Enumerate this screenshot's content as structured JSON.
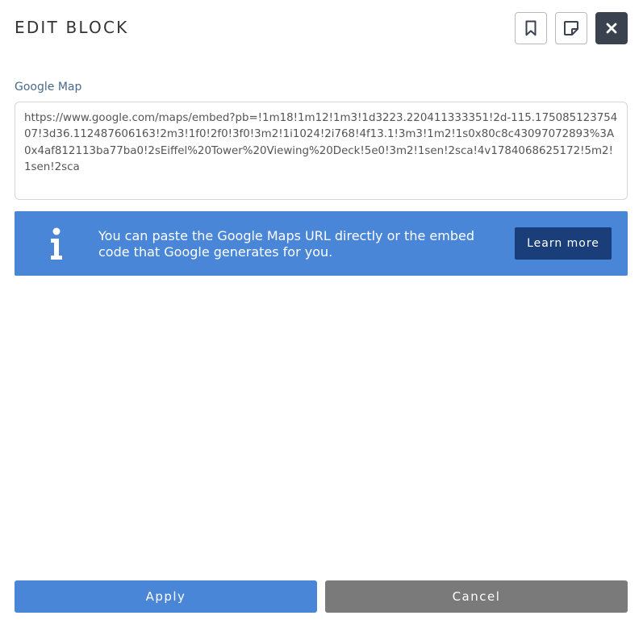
{
  "header": {
    "title": "EDIT BLOCK",
    "buttons": [
      {
        "icon": "bookmark-icon"
      },
      {
        "icon": "note-icon"
      },
      {
        "icon": "close-icon"
      }
    ]
  },
  "field": {
    "label": "Google Map",
    "value": "https://www.google.com/maps/embed?pb=!1m18!1m12!1m3!1d3223.220411333351!2d-115.17508512375407!3d36.112487606163!2m3!1f0!2f0!3f0!3m2!1i1024!2i768!4f13.1!3m3!1m2!1s0x80c8c43097072893%3A0x4af812113ba77ba0!2sEiffel%20Tower%20Viewing%20Deck!5e0!3m2!1sen!2sca!4v1784068625172!5m2!1sen!2sca"
  },
  "info": {
    "icon": "info-icon",
    "text": "You can paste the Google Maps URL directly or the embed code that Google generates for you.",
    "learn_more": "Learn more"
  },
  "footer": {
    "apply": "Apply",
    "cancel": "Cancel"
  },
  "colors": {
    "primary": "#4a86d8",
    "primary_dark": "#1a3e7a",
    "close_bg": "#39424e",
    "cancel_bg": "#7a7a7a",
    "label": "#4a6a8a"
  }
}
